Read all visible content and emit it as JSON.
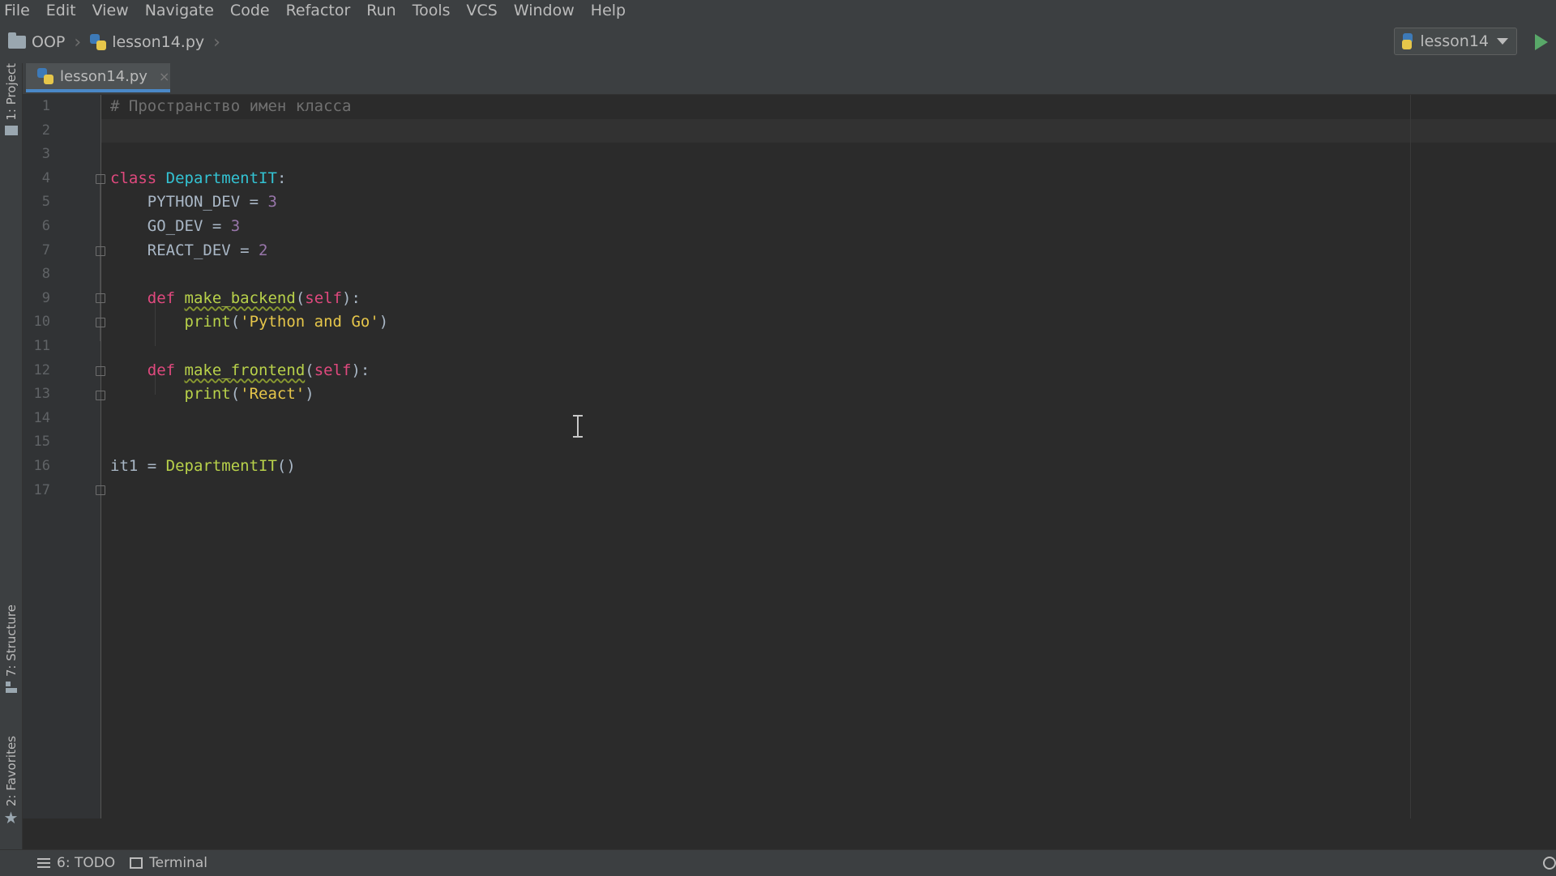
{
  "menu": [
    "File",
    "Edit",
    "View",
    "Navigate",
    "Code",
    "Refactor",
    "Run",
    "Tools",
    "VCS",
    "Window",
    "Help"
  ],
  "breadcrumb": {
    "project": "OOP",
    "file": "lesson14.py"
  },
  "run_config": {
    "label": "lesson14"
  },
  "left_tools": {
    "project": "1: Project",
    "structure": "7: Structure",
    "favorites": "2: Favorites"
  },
  "tab": {
    "label": "lesson14.py",
    "close": "×"
  },
  "line_numbers": [
    "1",
    "2",
    "3",
    "4",
    "5",
    "6",
    "7",
    "8",
    "9",
    "10",
    "11",
    "12",
    "13",
    "14",
    "15",
    "16",
    "17"
  ],
  "code": {
    "l1": {
      "comment": "# Пространство имен класса"
    },
    "l4": {
      "kw": "class",
      "name": "DepartmentIT",
      "colon": ":"
    },
    "l5": {
      "indent": "    ",
      "var": "PYTHON_DEV = ",
      "val": "3"
    },
    "l6": {
      "indent": "    ",
      "var": "GO_DEV = ",
      "val": "3"
    },
    "l7": {
      "indent": "    ",
      "var": "REACT_DEV = ",
      "val": "2"
    },
    "l9": {
      "indent": "    ",
      "kw": "def",
      "name": "make_backend",
      "open": "(",
      "self": "self",
      "close": "):"
    },
    "l10": {
      "indent": "        ",
      "fn": "print",
      "open": "(",
      "str": "'Python and Go'",
      "close": ")"
    },
    "l12": {
      "indent": "    ",
      "kw": "def",
      "name": "make_frontend",
      "open": "(",
      "self": "self",
      "close": "):"
    },
    "l13": {
      "indent": "        ",
      "fn": "print",
      "open": "(",
      "str": "'React'",
      "close": ")"
    },
    "l16": {
      "var": "it1 = ",
      "cls": "DepartmentIT",
      "call": "()"
    }
  },
  "status": {
    "todo": "6: TODO",
    "terminal": "Terminal"
  },
  "colors": {
    "keyword": "#e0497e",
    "class_name": "#33c3d3",
    "function": "#b8d14a",
    "number": "#9876aa",
    "string": "#e6c64a",
    "comment": "#707070",
    "accent": "#4a88c7",
    "run": "#59a869"
  }
}
